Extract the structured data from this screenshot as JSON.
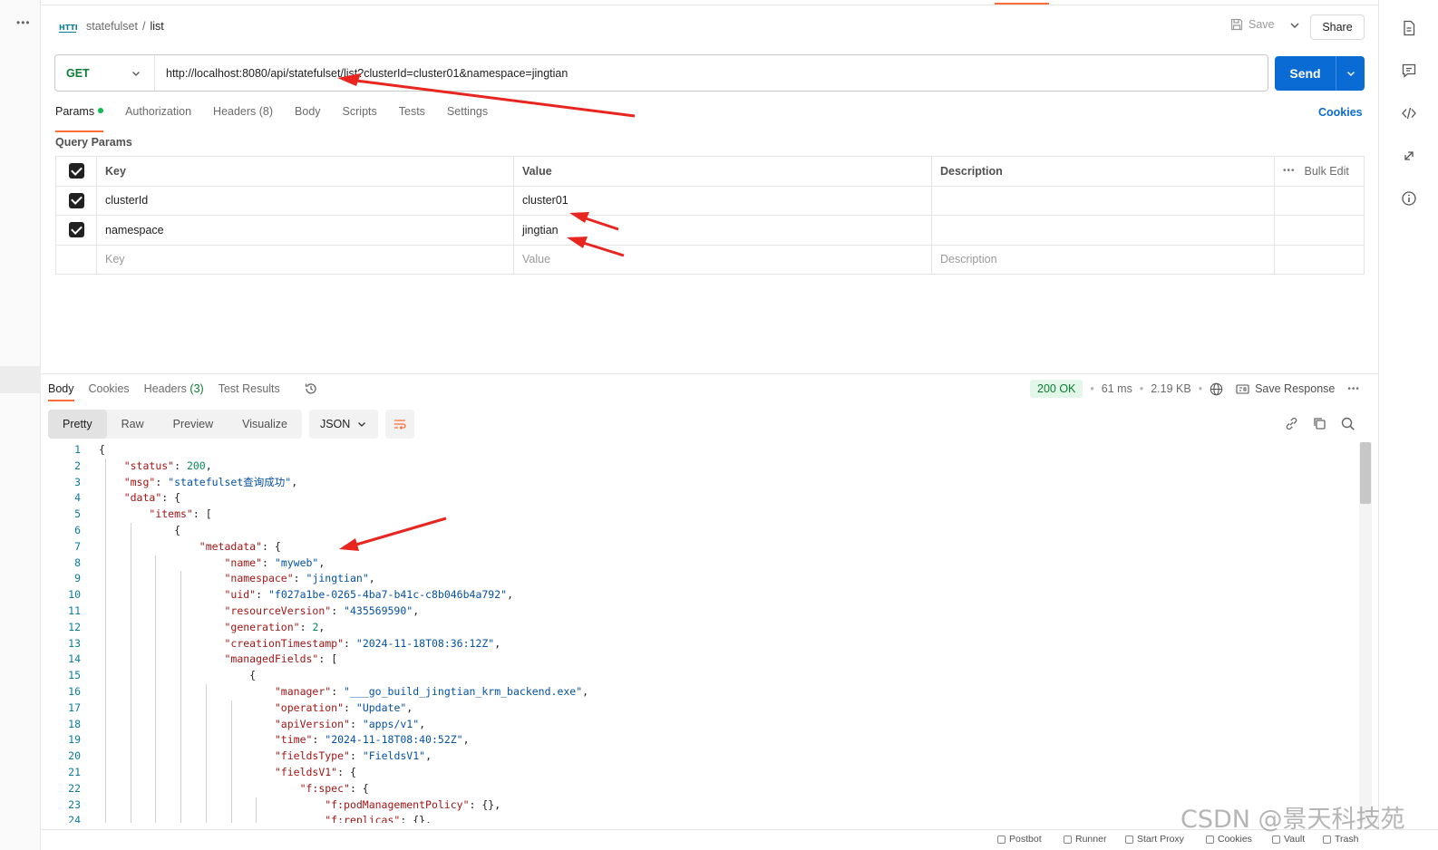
{
  "header": {
    "breadcrumb_parent": "statefulset",
    "breadcrumb_sep": "/",
    "breadcrumb_current": "list",
    "save_label": "Save",
    "share_label": "Share"
  },
  "request": {
    "method": "GET",
    "url": "http://localhost:8080/api/statefulset/list?clusterId=cluster01&namespace=jingtian",
    "send_label": "Send",
    "tabs": [
      {
        "label": "Params"
      },
      {
        "label": "Authorization"
      },
      {
        "label": "Headers (8)"
      },
      {
        "label": "Body"
      },
      {
        "label": "Scripts"
      },
      {
        "label": "Tests"
      },
      {
        "label": "Settings"
      }
    ],
    "cookies_label": "Cookies",
    "query_params_title": "Query Params",
    "table": {
      "headers": {
        "key": "Key",
        "value": "Value",
        "description": "Description",
        "bulk_edit": "Bulk Edit"
      },
      "rows": [
        {
          "key": "clusterId",
          "value": "cluster01"
        },
        {
          "key": "namespace",
          "value": "jingtian"
        }
      ],
      "placeholders": {
        "key": "Key",
        "value": "Value",
        "description": "Description"
      }
    }
  },
  "response": {
    "tabs": [
      {
        "label": "Body"
      },
      {
        "label": "Cookies"
      },
      {
        "label": "Headers ",
        "count": "(3)"
      },
      {
        "label": "Test Results"
      }
    ],
    "status": "200 OK",
    "time": "61 ms",
    "size": "2.19 KB",
    "save_response_label": "Save Response",
    "view_tabs": [
      "Pretty",
      "Raw",
      "Preview",
      "Visualize"
    ],
    "format": "JSON",
    "code_lines": [
      {
        "n": "1",
        "t": "{"
      },
      {
        "n": "2",
        "t": "    \"status\": 200,"
      },
      {
        "n": "3",
        "t": "    \"msg\": \"statefulset查询成功\","
      },
      {
        "n": "4",
        "t": "    \"data\": {"
      },
      {
        "n": "5",
        "t": "        \"items\": ["
      },
      {
        "n": "6",
        "t": "            {"
      },
      {
        "n": "7",
        "t": "                \"metadata\": {"
      },
      {
        "n": "8",
        "t": "                    \"name\": \"myweb\","
      },
      {
        "n": "9",
        "t": "                    \"namespace\": \"jingtian\","
      },
      {
        "n": "10",
        "t": "                    \"uid\": \"f027a1be-0265-4ba7-b41c-c8b046b4a792\","
      },
      {
        "n": "11",
        "t": "                    \"resourceVersion\": \"435569590\","
      },
      {
        "n": "12",
        "t": "                    \"generation\": 2,"
      },
      {
        "n": "13",
        "t": "                    \"creationTimestamp\": \"2024-11-18T08:36:12Z\","
      },
      {
        "n": "14",
        "t": "                    \"managedFields\": ["
      },
      {
        "n": "15",
        "t": "                        {"
      },
      {
        "n": "16",
        "t": "                            \"manager\": \"___go_build_jingtian_krm_backend.exe\","
      },
      {
        "n": "17",
        "t": "                            \"operation\": \"Update\","
      },
      {
        "n": "18",
        "t": "                            \"apiVersion\": \"apps/v1\","
      },
      {
        "n": "19",
        "t": "                            \"time\": \"2024-11-18T08:40:52Z\","
      },
      {
        "n": "20",
        "t": "                            \"fieldsType\": \"FieldsV1\","
      },
      {
        "n": "21",
        "t": "                            \"fieldsV1\": {"
      },
      {
        "n": "22",
        "t": "                                \"f:spec\": {"
      },
      {
        "n": "23",
        "t": "                                    \"f:podManagementPolicy\": {},"
      },
      {
        "n": "24",
        "t": "                                    \"f:replicas\": {},"
      }
    ]
  },
  "footer": {
    "items": [
      "Postbot",
      "Runner",
      "Start Proxy",
      "Cookies",
      "Vault",
      "Trash"
    ]
  },
  "watermark": "CSDN @景天科技苑",
  "colors": {
    "accent": "#ff6c37",
    "send": "#0b6bd5",
    "method_get": "#0a7c33",
    "annotation_arrow": "#e8261f"
  }
}
